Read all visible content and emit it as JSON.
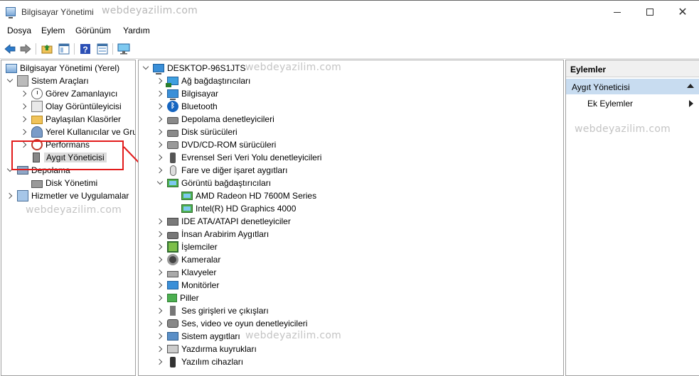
{
  "window": {
    "title": "Bilgisayar Yönetimi",
    "watermark": "webdeyazilim.com"
  },
  "menu": [
    "Dosya",
    "Eylem",
    "Görünüm",
    "Yardım"
  ],
  "toolbar": {
    "icons": [
      "back-arrow-icon",
      "forward-arrow-icon",
      "up-folder-icon",
      "show-hide-tree-icon",
      "help-icon",
      "properties-icon",
      "monitor-icon"
    ]
  },
  "left_tree": {
    "root": "Bilgisayar Yönetimi (Yerel)",
    "system_tools": "Sistem Araçları",
    "task_scheduler": "Görev Zamanlayıcı",
    "event_viewer": "Olay Görüntüleyicisi",
    "shared_folders": "Paylaşılan Klasörler",
    "local_users": "Yerel Kullanıcılar ve Gru",
    "performance": "Performans",
    "device_manager": "Aygıt Yöneticisi",
    "storage": "Depolama",
    "disk_management": "Disk Yönetimi",
    "services": "Hizmetler ve Uygulamalar"
  },
  "device_tree": {
    "root": "DESKTOP-96S1JTS",
    "categories": [
      {
        "label": "Ağ bağdaştırıcıları",
        "icon": "network-adapter-icon"
      },
      {
        "label": "Bilgisayar",
        "icon": "computer-icon"
      },
      {
        "label": "Bluetooth",
        "icon": "bluetooth-icon"
      },
      {
        "label": "Depolama denetleyicileri",
        "icon": "storage-controller-icon"
      },
      {
        "label": "Disk sürücüleri",
        "icon": "disk-drive-icon"
      },
      {
        "label": "DVD/CD-ROM sürücüleri",
        "icon": "dvd-drive-icon"
      },
      {
        "label": "Evrensel Seri Veri Yolu denetleyicileri",
        "icon": "usb-icon"
      },
      {
        "label": "Fare ve diğer işaret aygıtları",
        "icon": "mouse-icon"
      },
      {
        "label": "Görüntü bağdaştırıcıları",
        "icon": "display-adapter-icon"
      },
      {
        "label": "IDE ATA/ATAPI denetleyiciler",
        "icon": "ide-controller-icon"
      },
      {
        "label": "İnsan Arabirim Aygıtları",
        "icon": "hid-icon"
      },
      {
        "label": "İşlemciler",
        "icon": "processor-icon"
      },
      {
        "label": "Kameralar",
        "icon": "camera-icon"
      },
      {
        "label": "Klavyeler",
        "icon": "keyboard-icon"
      },
      {
        "label": "Monitörler",
        "icon": "monitor-icon"
      },
      {
        "label": "Piller",
        "icon": "battery-icon"
      },
      {
        "label": "Ses girişleri ve çıkışları",
        "icon": "audio-io-icon"
      },
      {
        "label": "Ses, video ve oyun denetleyicileri",
        "icon": "sound-controller-icon"
      },
      {
        "label": "Sistem aygıtları",
        "icon": "system-devices-icon"
      },
      {
        "label": "Yazdırma kuyrukları",
        "icon": "print-queue-icon"
      },
      {
        "label": "Yazılım cihazları",
        "icon": "software-device-icon"
      }
    ],
    "display_children": [
      "AMD Radeon HD 7600M Series",
      "Intel(R) HD Graphics 4000"
    ]
  },
  "actions": {
    "header": "Eylemler",
    "section": "Aygıt Yöneticisi",
    "more": "Ek Eylemler"
  },
  "colors": {
    "annotation": "#e21b1b",
    "selection": "#c8dcf0"
  }
}
